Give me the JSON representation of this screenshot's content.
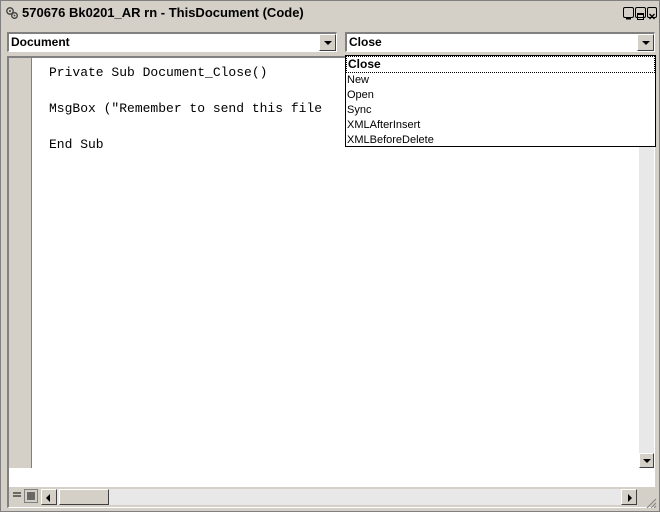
{
  "window": {
    "title": "570676 Bk0201_AR rn - ThisDocument (Code)"
  },
  "object_combo": {
    "value": "Document"
  },
  "procedure_combo": {
    "value": "Close",
    "options": [
      "Close",
      "New",
      "Open",
      "Sync",
      "XMLAfterInsert",
      "XMLBeforeDelete"
    ]
  },
  "code": {
    "lines": [
      "Private Sub Document_Close()",
      "MsgBox (\"Remember to send this file",
      "End Sub"
    ]
  },
  "icons": {
    "title": "vba-module-icon",
    "minimize": "minimize-icon",
    "maximize": "maximize-icon",
    "close": "close-icon"
  }
}
